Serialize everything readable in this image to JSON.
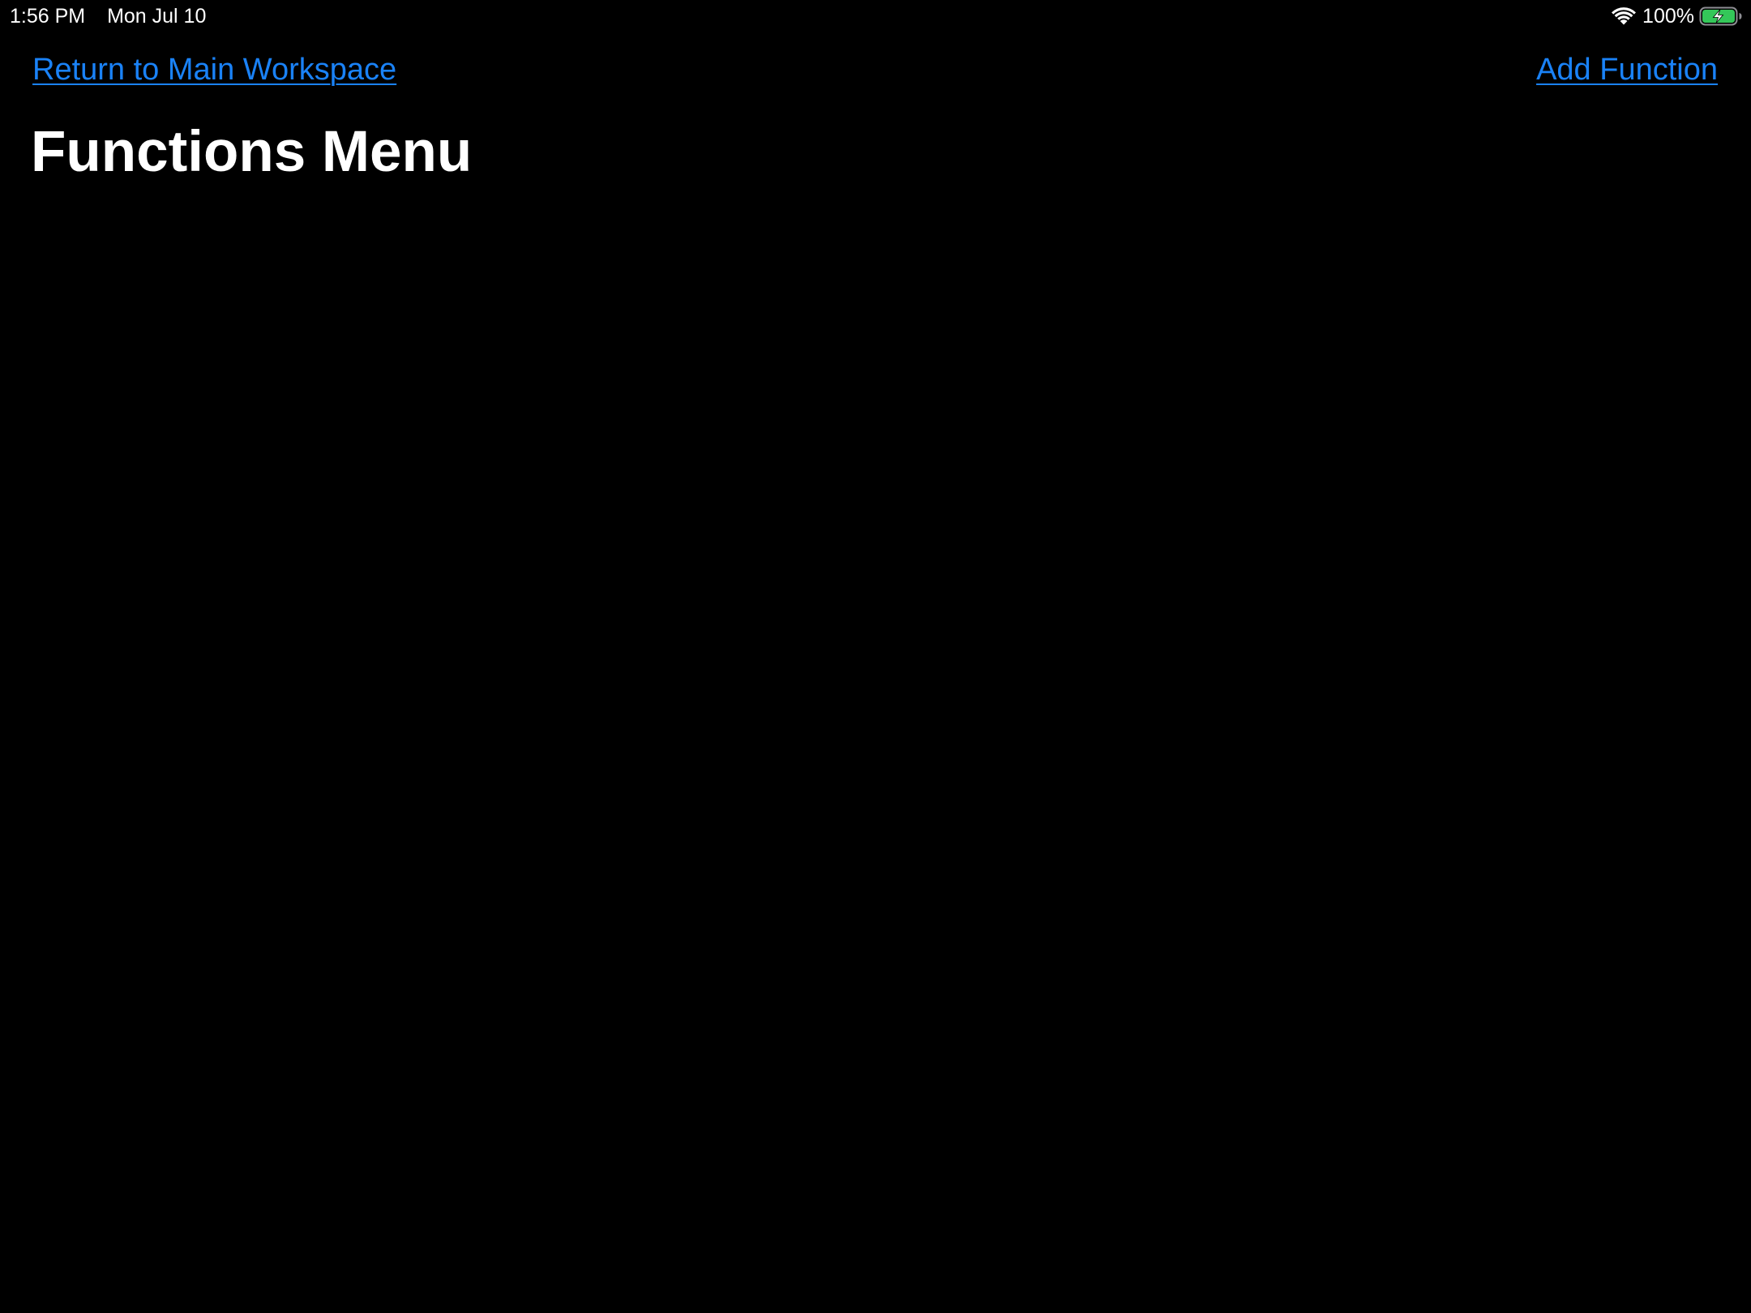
{
  "status_bar": {
    "time": "1:56 PM",
    "date": "Mon Jul 10",
    "wifi_icon": "wifi-icon",
    "battery_percent": "100%",
    "battery_icon": "battery-charging-icon",
    "battery_level": 1.0,
    "battery_color": "#34c759"
  },
  "nav": {
    "back_label": "Return to Main Workspace",
    "add_label": "Add Function",
    "link_color": "#1a82f7"
  },
  "page": {
    "title": "Functions Menu",
    "background": "#000000",
    "text_color": "#ffffff"
  }
}
